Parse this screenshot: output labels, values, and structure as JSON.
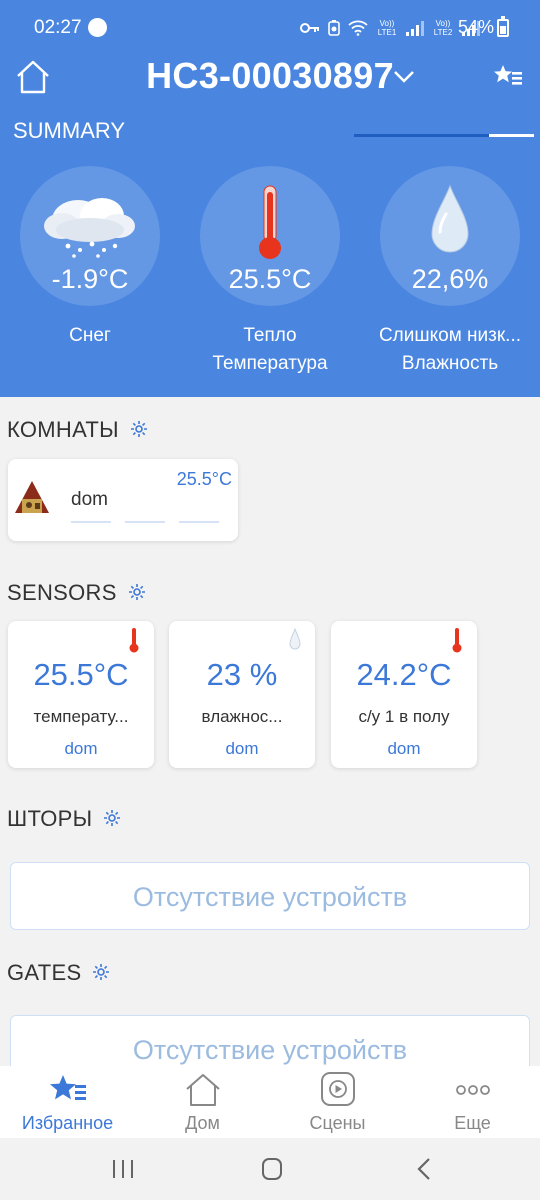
{
  "status_bar": {
    "time": "02:27",
    "lte1": "Vo)) LTE1",
    "lte2": "Vo)) LTE2",
    "battery": "54%"
  },
  "header": {
    "title": "HC3-00030897",
    "summary_label": "SUMMARY"
  },
  "weather": [
    {
      "value": "-1.9°C",
      "label": "Снег",
      "icon": "snow-cloud-icon"
    },
    {
      "value": "25.5°C",
      "label_line1": "Тепло",
      "label_line2": "Температура",
      "icon": "thermometer-icon"
    },
    {
      "value": "22,6%",
      "label_line1": "Слишком низк...",
      "label_line2": "Влажность",
      "icon": "water-drop-icon"
    }
  ],
  "rooms": {
    "title": "КОМНАТЫ",
    "items": [
      {
        "name": "dom",
        "temperature": "25.5°C"
      }
    ]
  },
  "sensors": {
    "title": "SENSORS",
    "items": [
      {
        "value": "25.5°C",
        "name": "температу...",
        "room": "dom",
        "icon": "thermometer-icon"
      },
      {
        "value": "23 %",
        "name": "влажнос...",
        "room": "dom",
        "icon": "water-drop-icon"
      },
      {
        "value": "24.2°C",
        "name": "с/у 1 в полу",
        "room": "dom",
        "icon": "thermometer-icon"
      }
    ]
  },
  "shades": {
    "title": "ШТОРЫ",
    "empty_text": "Отсутствие устройств"
  },
  "gates": {
    "title": "GATES",
    "empty_text": "Отсутствие устройств"
  },
  "bottom_nav": [
    {
      "label": "Избранное",
      "icon": "favorites-icon",
      "active": true
    },
    {
      "label": "Дом",
      "icon": "house-icon",
      "active": false
    },
    {
      "label": "Сцены",
      "icon": "scenes-play-icon",
      "active": false
    },
    {
      "label": "Еще",
      "icon": "more-icon",
      "active": false
    }
  ],
  "colors": {
    "header_blue": "#4a86e0",
    "accent_blue": "#3c78d8",
    "thermometer_red": "#e8341c"
  }
}
